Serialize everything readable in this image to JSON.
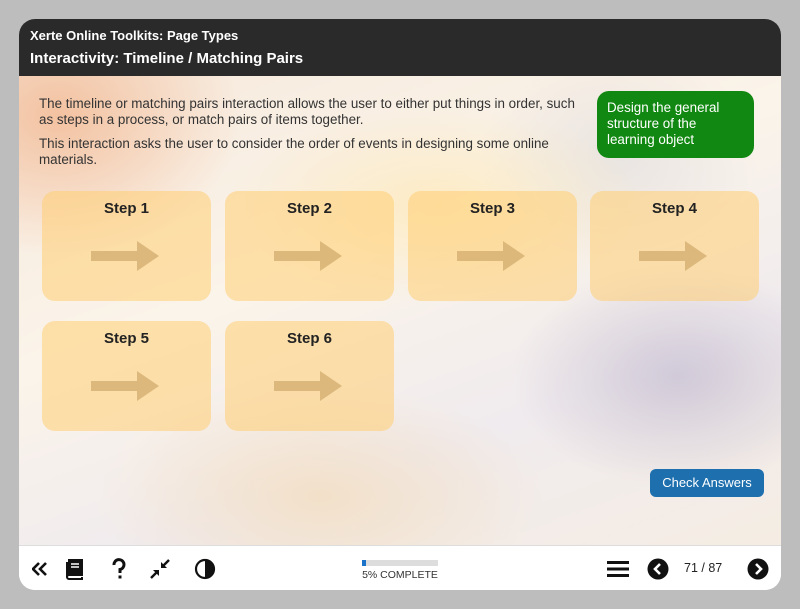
{
  "header": {
    "app_title": "Xerte Online Toolkits: Page Types",
    "page_title": "Interactivity: Timeline / Matching Pairs"
  },
  "intro": {
    "paragraph1": "The timeline or matching pairs interaction allows the user to either put things in order, such as steps in a process, or match pairs of items together.",
    "paragraph2": "This interaction asks the user to consider the order of events in designing some online materials."
  },
  "drag_item": {
    "text": "Design the general structure of the learning object",
    "color": "#118811"
  },
  "steps": [
    {
      "label": "Step 1"
    },
    {
      "label": "Step 2"
    },
    {
      "label": "Step 3"
    },
    {
      "label": "Step 4"
    },
    {
      "label": "Step 5"
    },
    {
      "label": "Step 6"
    }
  ],
  "actions": {
    "check_answers": "Check Answers"
  },
  "footer": {
    "icons": [
      "double-chevron-left-icon",
      "glossary-book-icon",
      "help-question-icon",
      "collapse-arrows-icon",
      "contrast-icon",
      "menu-icon",
      "previous-circle-icon",
      "next-circle-icon"
    ],
    "progress_fraction": 0.05,
    "progress_text": "5% COMPLETE",
    "page_counter": "71 / 87"
  },
  "colors": {
    "accent_blue": "#1d6fae",
    "step_fill": "#ffcd73",
    "header_bg": "#2a2a2a"
  }
}
